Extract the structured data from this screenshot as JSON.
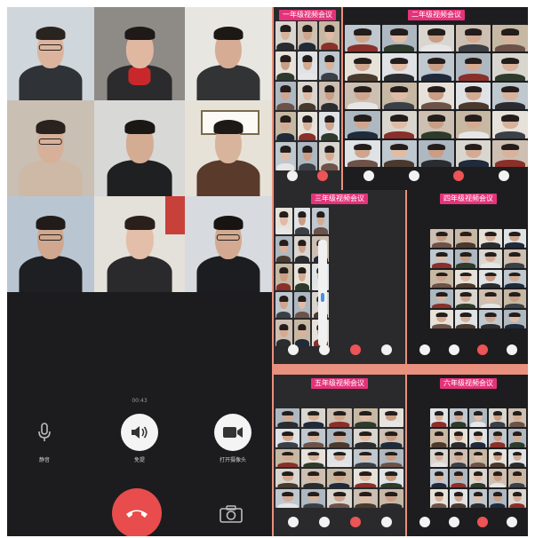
{
  "call_controls": {
    "timer": "00:43",
    "mute_label": "静音",
    "speaker_label": "免提",
    "camera_label": "打开摄像头"
  },
  "panels": [
    {
      "title": "一年级视频会议"
    },
    {
      "title": "二年级视频会议"
    },
    {
      "title": "三年级视频会议"
    },
    {
      "title": "四年级视频会议"
    },
    {
      "title": "五年级视频会议"
    },
    {
      "title": "六年级视频会议"
    }
  ],
  "colors": {
    "phone_bg": "#1c1c1e",
    "hangup_red": "#e84c4c",
    "banner_pink": "#e4337a",
    "collage_bg": "#e9907e"
  },
  "icons": {
    "mute": "microphone-icon",
    "speaker": "speaker-icon",
    "camera": "video-camera-icon",
    "hangup": "phone-hangup-icon",
    "switch_camera": "camera-switch-icon"
  }
}
